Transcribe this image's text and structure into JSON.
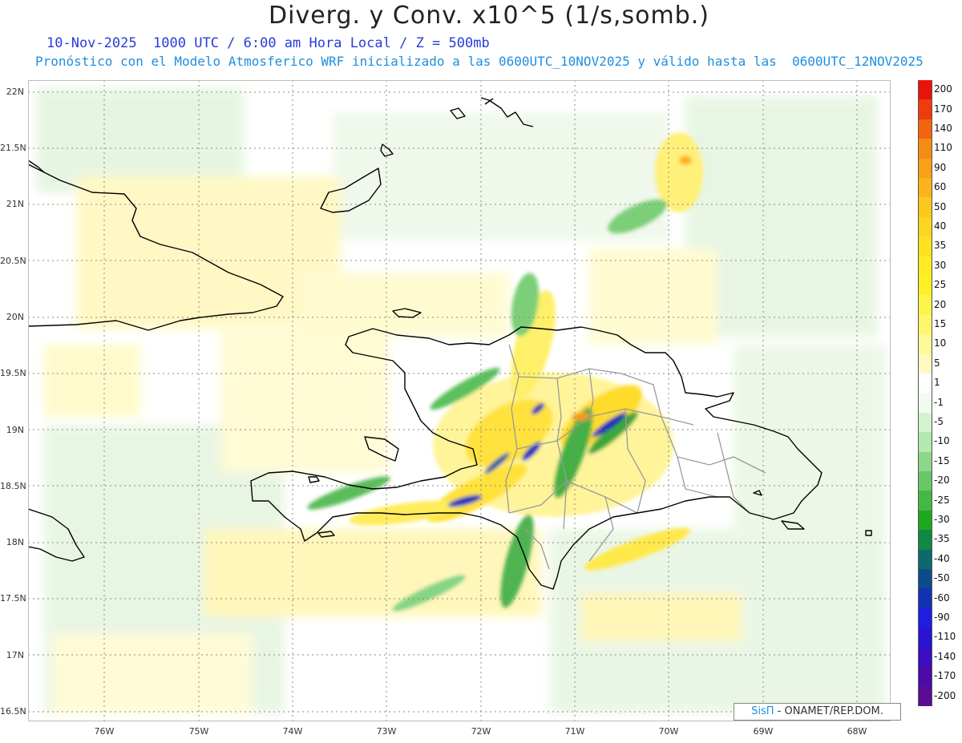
{
  "title": "Diverg. y Conv. x10^5 (1/s,somb.)",
  "subtitle_1": "10-Nov-2025  1000 UTC / 6:00 am Hora Local / Z = 500mb",
  "subtitle_2": "Pronóstico con el Modelo Atmosferico WRF inicializado a las 0600UTC_10NOV2025 y válido hasta las  0600UTC_12NOV2025",
  "lat_labels": [
    "22N",
    "21.5N",
    "21N",
    "20.5N",
    "20N",
    "19.5N",
    "19N",
    "18.5N",
    "18N",
    "17.5N",
    "17N",
    "16.5N"
  ],
  "lon_labels": [
    "76W",
    "75W",
    "74W",
    "73W",
    "72W",
    "71W",
    "70W",
    "69W",
    "68W"
  ],
  "colorbar": {
    "labels": [
      "200",
      "170",
      "140",
      "110",
      "90",
      "60",
      "50",
      "40",
      "35",
      "30",
      "25",
      "20",
      "15",
      "10",
      "5",
      "1",
      "-1",
      "-5",
      "-10",
      "-15",
      "-20",
      "-25",
      "-30",
      "-35",
      "-40",
      "-50",
      "-60",
      "-90",
      "-110",
      "-140",
      "-170",
      "-200"
    ],
    "colors": [
      "#e8140c",
      "#ee3c0c",
      "#f26410",
      "#f68c14",
      "#faa018",
      "#fcb41c",
      "#fdc81e",
      "#fed620",
      "#fee220",
      "#ffec22",
      "#fff026",
      "#fff44a",
      "#fff66e",
      "#fff896",
      "#fffbc0",
      "#ffffff",
      "#f2fbf0",
      "#d4f2d0",
      "#b4e8b0",
      "#8cd88a",
      "#66c866",
      "#44b844",
      "#1ea81e",
      "#118844",
      "#0c6a6a",
      "#0c4c8c",
      "#1232b4",
      "#1e1ee0",
      "#2a14d2",
      "#3a0ec0",
      "#4c0aa8",
      "#5a0c94"
    ]
  },
  "credit": {
    "brand": "SisΠ",
    "text": " - ONAMET/REP.DOM."
  },
  "map_colors": {
    "ocean": "#ffffff",
    "land_fill": "#f6fbf2",
    "coast": "#000000",
    "provinces": "#9a9a9a",
    "grid": "#888888"
  }
}
